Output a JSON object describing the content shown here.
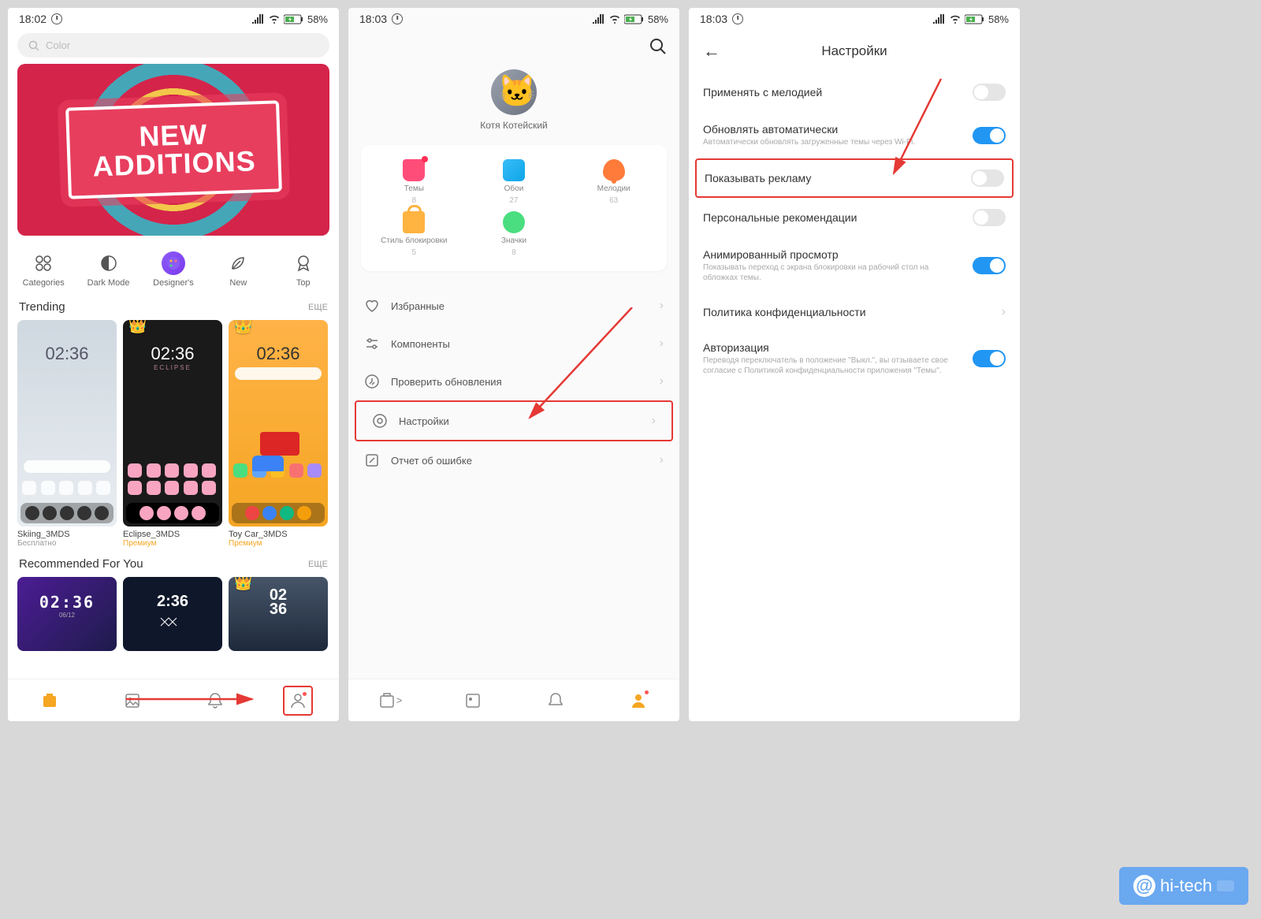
{
  "status": {
    "time1": "18:02",
    "time2": "18:03",
    "time3": "18:03",
    "battery": "58%"
  },
  "screen1": {
    "search_placeholder": "Color",
    "banner_line1": "NEW",
    "banner_line2": "ADDITIONS",
    "categories": [
      {
        "label": "Categories"
      },
      {
        "label": "Dark Mode"
      },
      {
        "label": "Designer's"
      },
      {
        "label": "New"
      },
      {
        "label": "Top"
      }
    ],
    "trending_title": "Trending",
    "more": "ЕЩЕ",
    "themes": [
      {
        "name": "Skiing_3MDS",
        "price": "Бесплатно",
        "clock": "02:36"
      },
      {
        "name": "Eclipse_3MDS",
        "price": "Премиум",
        "clock": "02:36",
        "sub": "ECLIPSE"
      },
      {
        "name": "Toy Car_3MDS",
        "price": "Премиум",
        "clock": "02:36"
      }
    ],
    "rec_title": "Recommended For You",
    "rec_clock1": "02:36",
    "rec_date1": "06/12",
    "rec_clock2": "2:36",
    "rec_clock3": "02\n36"
  },
  "screen2": {
    "username": "Котя Котейский",
    "grid": [
      {
        "label": "Темы",
        "count": "8"
      },
      {
        "label": "Обои",
        "count": "27"
      },
      {
        "label": "Мелодии",
        "count": "63"
      },
      {
        "label": "Стиль блокировки",
        "count": "5"
      },
      {
        "label": "Значки",
        "count": "8"
      }
    ],
    "menu": [
      {
        "label": "Избранные"
      },
      {
        "label": "Компоненты"
      },
      {
        "label": "Проверить обновления"
      },
      {
        "label": "Настройки"
      },
      {
        "label": "Отчет об ошибке"
      }
    ]
  },
  "screen3": {
    "title": "Настройки",
    "settings": [
      {
        "label": "Применять с мелодией",
        "on": false
      },
      {
        "label": "Обновлять автоматически",
        "sub": "Автоматически обновлять загруженные темы через Wi-Fi.",
        "on": true
      },
      {
        "label": "Показывать рекламу",
        "on": false
      },
      {
        "label": "Персональные рекомендации",
        "on": false
      },
      {
        "label": "Анимированный просмотр",
        "sub": "Показывать переход с экрана блокировки на рабочий стол на обложках темы.",
        "on": true
      },
      {
        "label": "Политика конфиденциальности",
        "chevron": true
      },
      {
        "label": "Авторизация",
        "sub": "Переводя переключатель в положение \"Выкл.\", вы отзываете свое согласие с Политикой конфиденциальности приложения \"Темы\".",
        "on": true
      }
    ]
  },
  "watermark": "hi-tech"
}
